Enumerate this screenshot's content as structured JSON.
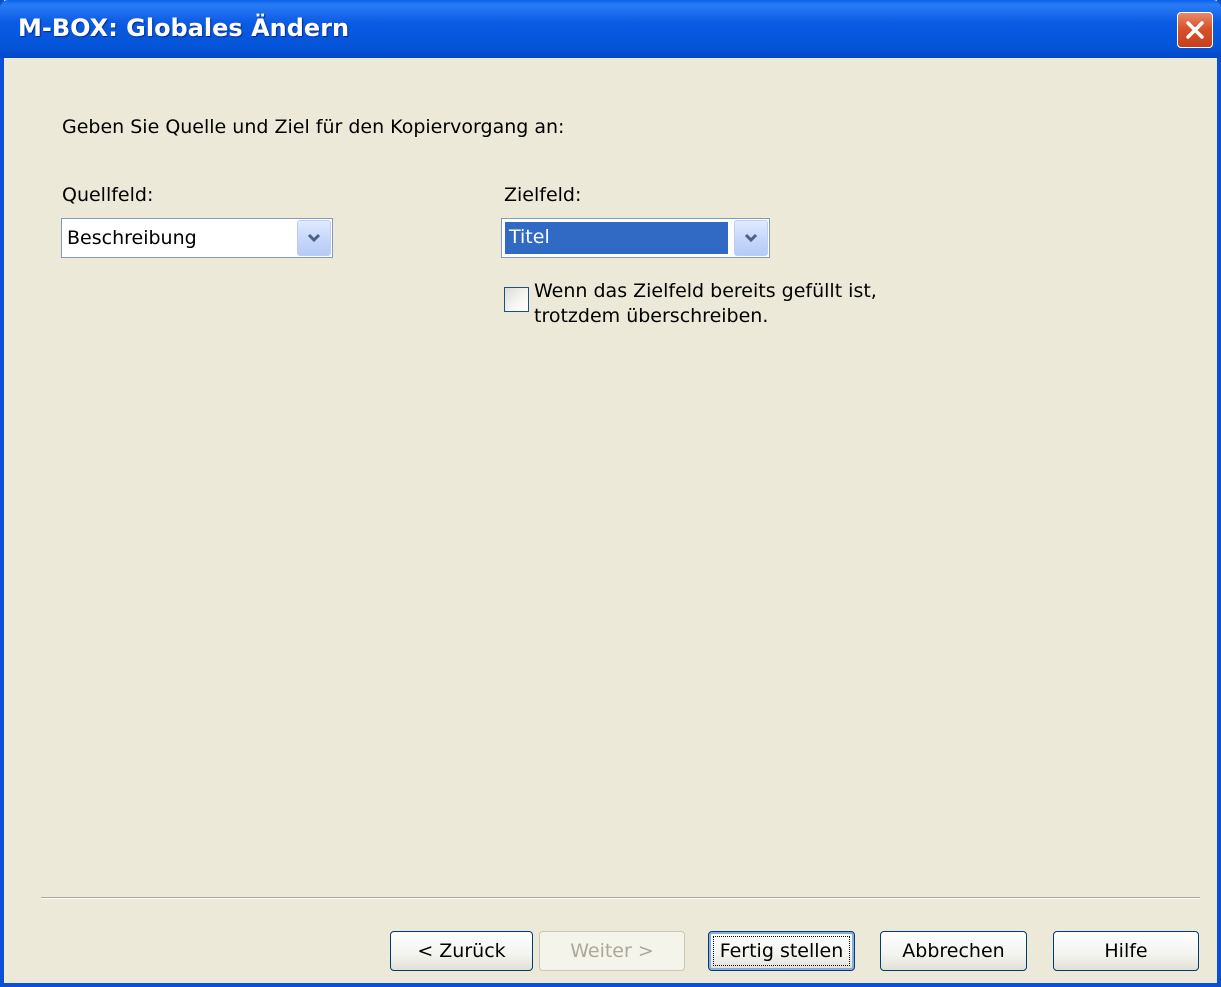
{
  "window": {
    "title": "M-BOX: Globales Ändern"
  },
  "content": {
    "instruction": "Geben Sie Quelle und Ziel für den Kopiervorgang an:",
    "source": {
      "label": "Quellfeld:",
      "value": "Beschreibung"
    },
    "target": {
      "label": "Zielfeld:",
      "value": "Titel"
    },
    "overwrite": {
      "checked": false,
      "label_line1": "Wenn das Zielfeld bereits gefüllt ist,",
      "label_line2": "trotzdem überschreiben."
    }
  },
  "buttons": {
    "back": "< Zurück",
    "next": "Weiter >",
    "finish": "Fertig stellen",
    "cancel": "Abbrechen",
    "help": "Hilfe"
  },
  "colors": {
    "titlebar": "#0a5ae4",
    "window_bg": "#ece9d8",
    "selection": "#316ac5",
    "close_button": "#d8522c"
  },
  "icons": {
    "close": "close-icon",
    "dropdown": "chevron-down-icon"
  }
}
